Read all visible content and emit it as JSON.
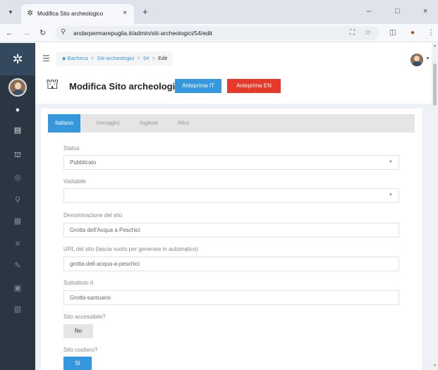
{
  "browser": {
    "tab_menu_icon": "chevron-down-icon",
    "tab_title": "Modifica Sito archeologico",
    "tab_close": "×",
    "new_tab": "+",
    "window_controls": {
      "minimize": "–",
      "maximize": "□",
      "close": "×"
    },
    "url": "andarpermarepuglia.it/admin/siti-archeologici/54/edit",
    "icons": [
      "back-icon",
      "forward-icon",
      "reload-icon",
      "site-info-icon",
      "translate-icon",
      "bookmark-star-icon",
      "extensions-icon",
      "profile-icon",
      "menu-dots-icon"
    ]
  },
  "breadcrumb": {
    "items": [
      "Bacheca",
      "Siti-archeologici",
      "54",
      "Edit"
    ],
    "separator": ">"
  },
  "header": {
    "title": "Modifica Sito archeologico",
    "preview_it": "Anteprima IT",
    "preview_en": "Anteprima EN"
  },
  "tabs": [
    {
      "label": "Italiano",
      "active": true
    },
    {
      "label": "Immagini",
      "active": false
    },
    {
      "label": "Inglese",
      "active": false
    },
    {
      "label": "Altro",
      "active": false
    }
  ],
  "form": {
    "status": {
      "label": "Status",
      "value": "Pubblicato"
    },
    "visitabile": {
      "label": "Visitabile",
      "value": ""
    },
    "denominazione": {
      "label": "Denominazione del sito",
      "value": "Grotta dell'Acqua a Peschici"
    },
    "url": {
      "label": "URL del sito (lascia vuoto per generare in automatico)",
      "value": "grotta-dell-acqua-a-peschici"
    },
    "sottotitolo": {
      "label": "Sottotitolo It",
      "value": "Grotta-santuario"
    },
    "accessibile": {
      "label": "Sito accessibile?",
      "value": "No"
    },
    "costiero": {
      "label": "Sito costiero?",
      "value": "Sì"
    }
  },
  "colors": {
    "sidebar": "#2b3643",
    "primary": "#3598dc",
    "danger": "#e7392b"
  }
}
